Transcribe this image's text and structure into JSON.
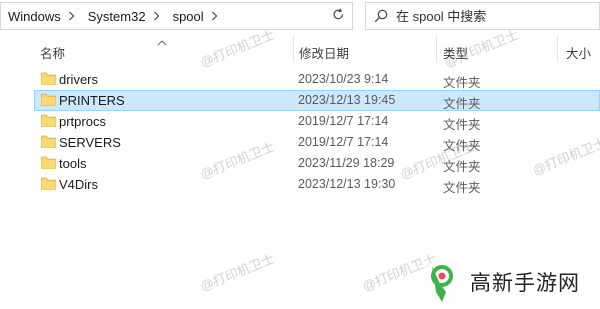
{
  "address_bar": {
    "breadcrumbs": [
      "Windows",
      "System32",
      "spool"
    ]
  },
  "search": {
    "placeholder": "在 spool 中搜索"
  },
  "columns": {
    "name": "名称",
    "modified": "修改日期",
    "type": "类型",
    "size": "大小"
  },
  "files": [
    {
      "name": "drivers",
      "modified": "2023/10/23 9:14",
      "type": "文件夹",
      "selected": false
    },
    {
      "name": "PRINTERS",
      "modified": "2023/12/13 19:45",
      "type": "文件夹",
      "selected": true
    },
    {
      "name": "prtprocs",
      "modified": "2019/12/7 17:14",
      "type": "文件夹",
      "selected": false
    },
    {
      "name": "SERVERS",
      "modified": "2019/12/7 17:14",
      "type": "文件夹",
      "selected": false
    },
    {
      "name": "tools",
      "modified": "2023/11/29 18:29",
      "type": "文件夹",
      "selected": false
    },
    {
      "name": "V4Dirs",
      "modified": "2023/12/13 19:30",
      "type": "文件夹",
      "selected": false
    }
  ],
  "watermark": "@打印机卫士",
  "brand": {
    "name": "高新手游网"
  },
  "colors": {
    "selection": "#cce8ff",
    "folder": "#f8d775",
    "brand_green": "#3cb44a"
  },
  "icons": [
    "chevron-right-icon",
    "chevron-down-icon",
    "refresh-icon",
    "search-icon",
    "folder-icon",
    "sort-up-icon"
  ]
}
